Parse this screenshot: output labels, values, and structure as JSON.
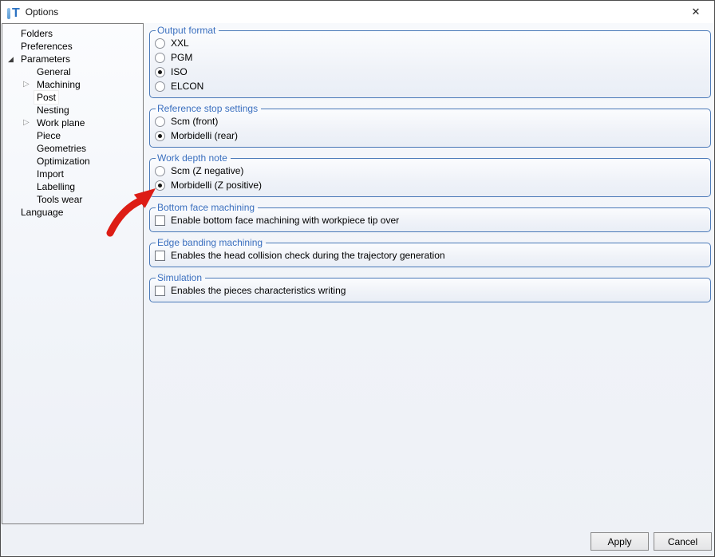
{
  "window": {
    "title": "Options"
  },
  "icons": {
    "app_t": "T",
    "close": "✕",
    "tree_expanded": "◢",
    "tree_collapsed": "▷"
  },
  "sidebar": {
    "items": [
      {
        "label": "Folders",
        "level": 0,
        "glyph": "none",
        "selected": false
      },
      {
        "label": "Preferences",
        "level": 0,
        "glyph": "none",
        "selected": false
      },
      {
        "label": "Parameters",
        "level": 0,
        "glyph": "expanded",
        "selected": false
      },
      {
        "label": "General",
        "level": 1,
        "glyph": "none",
        "selected": false
      },
      {
        "label": "Machining",
        "level": 1,
        "glyph": "collapsed",
        "selected": false
      },
      {
        "label": "Post",
        "level": 1,
        "glyph": "none",
        "selected": true
      },
      {
        "label": "Nesting",
        "level": 1,
        "glyph": "none",
        "selected": false
      },
      {
        "label": "Work plane",
        "level": 1,
        "glyph": "collapsed",
        "selected": false
      },
      {
        "label": "Piece",
        "level": 1,
        "glyph": "none",
        "selected": false
      },
      {
        "label": "Geometries",
        "level": 1,
        "glyph": "none",
        "selected": false
      },
      {
        "label": "Optimization",
        "level": 1,
        "glyph": "none",
        "selected": false
      },
      {
        "label": "Import",
        "level": 1,
        "glyph": "none",
        "selected": false
      },
      {
        "label": "Labelling",
        "level": 1,
        "glyph": "none",
        "selected": false
      },
      {
        "label": "Tools wear",
        "level": 1,
        "glyph": "none",
        "selected": false
      },
      {
        "label": "Language",
        "level": 0,
        "glyph": "none",
        "selected": false
      }
    ]
  },
  "groups": [
    {
      "title": "Output format",
      "control": "radio",
      "options": [
        {
          "label": "XXL",
          "selected": false
        },
        {
          "label": "PGM",
          "selected": false
        },
        {
          "label": "ISO",
          "selected": true
        },
        {
          "label": "ELCON",
          "selected": false
        }
      ]
    },
    {
      "title": "Reference stop settings",
      "control": "radio",
      "options": [
        {
          "label": "Scm (front)",
          "selected": false
        },
        {
          "label": "Morbidelli (rear)",
          "selected": true
        }
      ]
    },
    {
      "title": "Work depth note",
      "control": "radio",
      "options": [
        {
          "label": "Scm (Z negative)",
          "selected": false
        },
        {
          "label": "Morbidelli (Z positive)",
          "selected": true
        }
      ]
    },
    {
      "title": "Bottom face machining",
      "control": "checkbox",
      "options": [
        {
          "label": "Enable bottom face machining with workpiece tip over",
          "selected": false
        }
      ]
    },
    {
      "title": "Edge banding machining",
      "control": "checkbox",
      "options": [
        {
          "label": "Enables the head collision check during the trajectory generation",
          "selected": false
        }
      ]
    },
    {
      "title": "Simulation",
      "control": "checkbox",
      "options": [
        {
          "label": "Enables the pieces characteristics writing",
          "selected": false
        }
      ]
    }
  ],
  "footer": {
    "apply": "Apply",
    "cancel": "Cancel"
  },
  "annotation": {
    "arrow_color": "#dd1d15"
  },
  "colors": {
    "group_border": "#4a79b8",
    "group_title": "#3a6fbf",
    "app_icon_blue": "#2b72c2"
  }
}
